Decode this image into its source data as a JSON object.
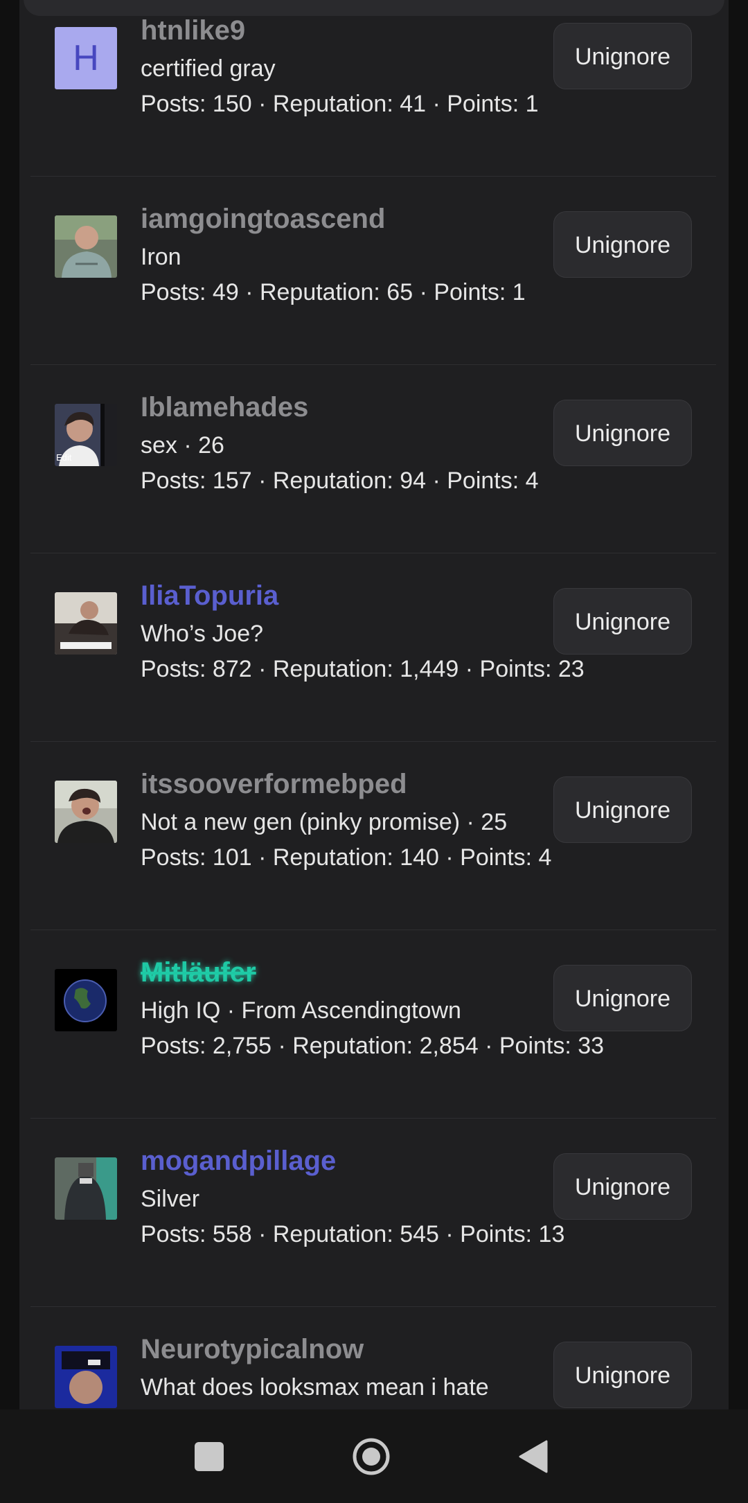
{
  "users": [
    {
      "username": "htnlike9",
      "avatar_letter": "H",
      "subtitle": "certified gray",
      "stats": "Posts: 150 · Reputation: 41 · Points: 1",
      "button": "Unignore"
    },
    {
      "username": "iamgoingtoascend",
      "subtitle": "Iron",
      "stats": "Posts: 49 · Reputation: 65 · Points: 1",
      "button": "Unignore"
    },
    {
      "username": "Iblamehades",
      "avatar_caption": "Edit",
      "subtitle": "sex · 26",
      "stats": "Posts: 157 · Reputation: 94 · Points: 4",
      "button": "Unignore"
    },
    {
      "username": "IliaTopuria",
      "subtitle": "Who’s Joe?",
      "stats": "Posts: 872 · Reputation: 1,449 · Points: 23",
      "button": "Unignore"
    },
    {
      "username": "itssooverformebped",
      "subtitle": "Not a new gen (pinky promise) · 25",
      "stats": "Posts: 101 · Reputation: 140 · Points: 4",
      "button": "Unignore"
    },
    {
      "username": "Mitläufer",
      "subtitle": "High IQ · From Ascendingtown",
      "stats": "Posts: 2,755 · Reputation: 2,854 · Points: 33",
      "button": "Unignore"
    },
    {
      "username": "mogandpillage",
      "subtitle": "Silver",
      "stats": "Posts: 558 · Reputation: 545 · Points: 13",
      "button": "Unignore"
    },
    {
      "username": "Neurotypicalnow",
      "subtitle": "What does looksmax mean i hate",
      "button": "Unignore"
    }
  ],
  "colors": {
    "username_gray": "#8d8d90",
    "username_blue": "#5a5fcf",
    "username_green": "#1ec8a4",
    "panel_bg": "#1f1f21",
    "button_bg": "#2b2b2e"
  },
  "navbar": {
    "recents_icon": "square-icon",
    "home_icon": "circle-home-icon",
    "back_icon": "triangle-back-icon"
  }
}
